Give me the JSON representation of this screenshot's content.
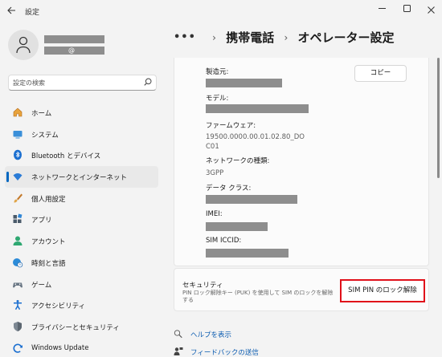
{
  "window": {
    "title": "設定",
    "controls": [
      "minimize",
      "maximize",
      "close"
    ]
  },
  "user": {
    "email_at": "@"
  },
  "search": {
    "placeholder": "設定の検索"
  },
  "sidebar": {
    "items": [
      {
        "label": "ホーム",
        "icon": "home-icon"
      },
      {
        "label": "システム",
        "icon": "system-icon"
      },
      {
        "label": "Bluetooth とデバイス",
        "icon": "bluetooth-icon"
      },
      {
        "label": "ネットワークとインターネット",
        "icon": "wifi-icon",
        "active": true
      },
      {
        "label": "個人用設定",
        "icon": "brush-icon"
      },
      {
        "label": "アプリ",
        "icon": "apps-icon"
      },
      {
        "label": "アカウント",
        "icon": "account-icon"
      },
      {
        "label": "時刻と言語",
        "icon": "globe-clock-icon"
      },
      {
        "label": "ゲーム",
        "icon": "gamepad-icon"
      },
      {
        "label": "アクセシビリティ",
        "icon": "accessibility-icon"
      },
      {
        "label": "プライバシーとセキュリティ",
        "icon": "shield-icon"
      },
      {
        "label": "Windows Update",
        "icon": "update-icon"
      }
    ]
  },
  "breadcrumb": {
    "more": "•••",
    "parent": "携帯電話",
    "current": "オペレーター設定"
  },
  "details": {
    "copy_label": "コピー",
    "manufacturer_label": "製造元:",
    "model_label": "モデル:",
    "firmware_label": "ファームウェア:",
    "firmware_value_line1": "19500.0000.00.01.02.80_DO",
    "firmware_value_line2": "C01",
    "network_type_label": "ネットワークの種類:",
    "network_type_value": "3GPP",
    "data_class_label": "データ クラス:",
    "imei_label": "IMEI:",
    "iccid_label": "SIM ICCID:"
  },
  "security": {
    "title": "セキュリティ",
    "description": "PIN ロック解除キー (PUK) を使用して SIM のロックを解除する",
    "button_label": "SIM PIN のロック解除"
  },
  "links": {
    "help": "ヘルプを表示",
    "feedback": "フィードバックの送信"
  },
  "colors": {
    "accent": "#0067c0",
    "highlight_border": "#e0101a",
    "redaction": "#8e8e8e"
  }
}
